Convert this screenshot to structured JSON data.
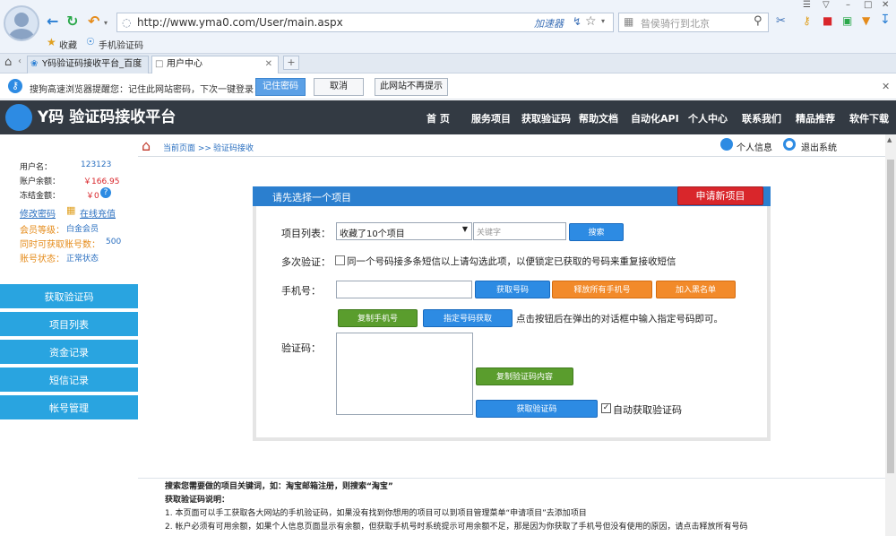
{
  "browser": {
    "url": "http://www.yma0.com/User/main.aspx",
    "accelerator_label": "加速器",
    "search_placeholder": "昝侯骑行到北京",
    "favorites": [
      "收藏",
      "手机验证码"
    ],
    "tabs": [
      {
        "label": "Y码验证码接收平台_百度"
      },
      {
        "label": "用户中心"
      }
    ],
    "notice": {
      "text": "搜狗高速浏览器提醒您：记住此网站密码，下次一键登录！",
      "remember_label": "记住密码",
      "cancel_label": "取消",
      "never_label": "此网站不再提示"
    }
  },
  "site": {
    "logo_text": "Y码 验证码接收平台",
    "nav": [
      "首 页",
      "服务项目",
      "获取验证码",
      "帮助文档",
      "自动化API",
      "个人中心",
      "联系我们",
      "精品推荐",
      "软件下载"
    ]
  },
  "breadcrumb": {
    "current_label": "当前页面 >>",
    "page": "验证码接收",
    "profile_label": "个人信息",
    "logout_label": "退出系统"
  },
  "user": {
    "username_label": "用户名：",
    "username": "123123",
    "balance_label": "账户余额：",
    "balance": "￥166.95",
    "frozen_label": "冻结金额：",
    "frozen": "￥0",
    "change_password": "修改密码",
    "recharge": "在线充值",
    "level_label": "会员等级：",
    "level": "白金会员",
    "concurrent_label": "同时可获取账号数：",
    "concurrent": "500",
    "status_label": "账号状态：",
    "status": "正常状态"
  },
  "side_menu": [
    "获取验证码",
    "项目列表",
    "资金记录",
    "短信记录",
    "帐号管理"
  ],
  "panel": {
    "title": "请先选择一个项目",
    "new_project": "申请新项目",
    "project_list_label": "项目列表：",
    "project_selected": "收藏了10个项目",
    "keyword_placeholder": "关键字",
    "search_btn": "搜索",
    "multi_label": "多次验证：",
    "multi_text": "同一个号码接多条短信以上请勾选此项，以便锁定已获取的号码来重复接收短信",
    "phone_label": "手机号：",
    "get_number": "获取号码",
    "release_all": "释放所有手机号",
    "blacklist": "加入黑名单",
    "copy_phone": "复制手机号",
    "specify_number": "指定号码获取",
    "specify_hint": "点击按钮后在弹出的对话框中输入指定号码即可。",
    "code_label": "验证码：",
    "copy_code": "复制验证码内容",
    "get_code": "获取验证码",
    "auto_label": "自动获取验证码"
  },
  "notes": {
    "keyword_tip": "搜索您需要做的项目关键词，如：淘宝邮箱注册，则搜索“淘宝”",
    "desc_title": "获取验证码说明：",
    "line1": "1. 本页面可以手工获取各大网站的手机验证码，如果没有找到你想用的项目可以到项目管理菜单“申请项目”去添加项目",
    "line2": "2. 帐户必须有可用余额，如果个人信息页面显示有余额，但获取手机号时系统提示可用余额不足，那是因为你获取了手机号但没有使用的原因，请点击释放所有号码"
  },
  "colors": {
    "header_bg": "#333a43",
    "menu_blue": "#29a4e0",
    "panel_blue": "#2b7fcf",
    "red_button": "#d9262b"
  }
}
